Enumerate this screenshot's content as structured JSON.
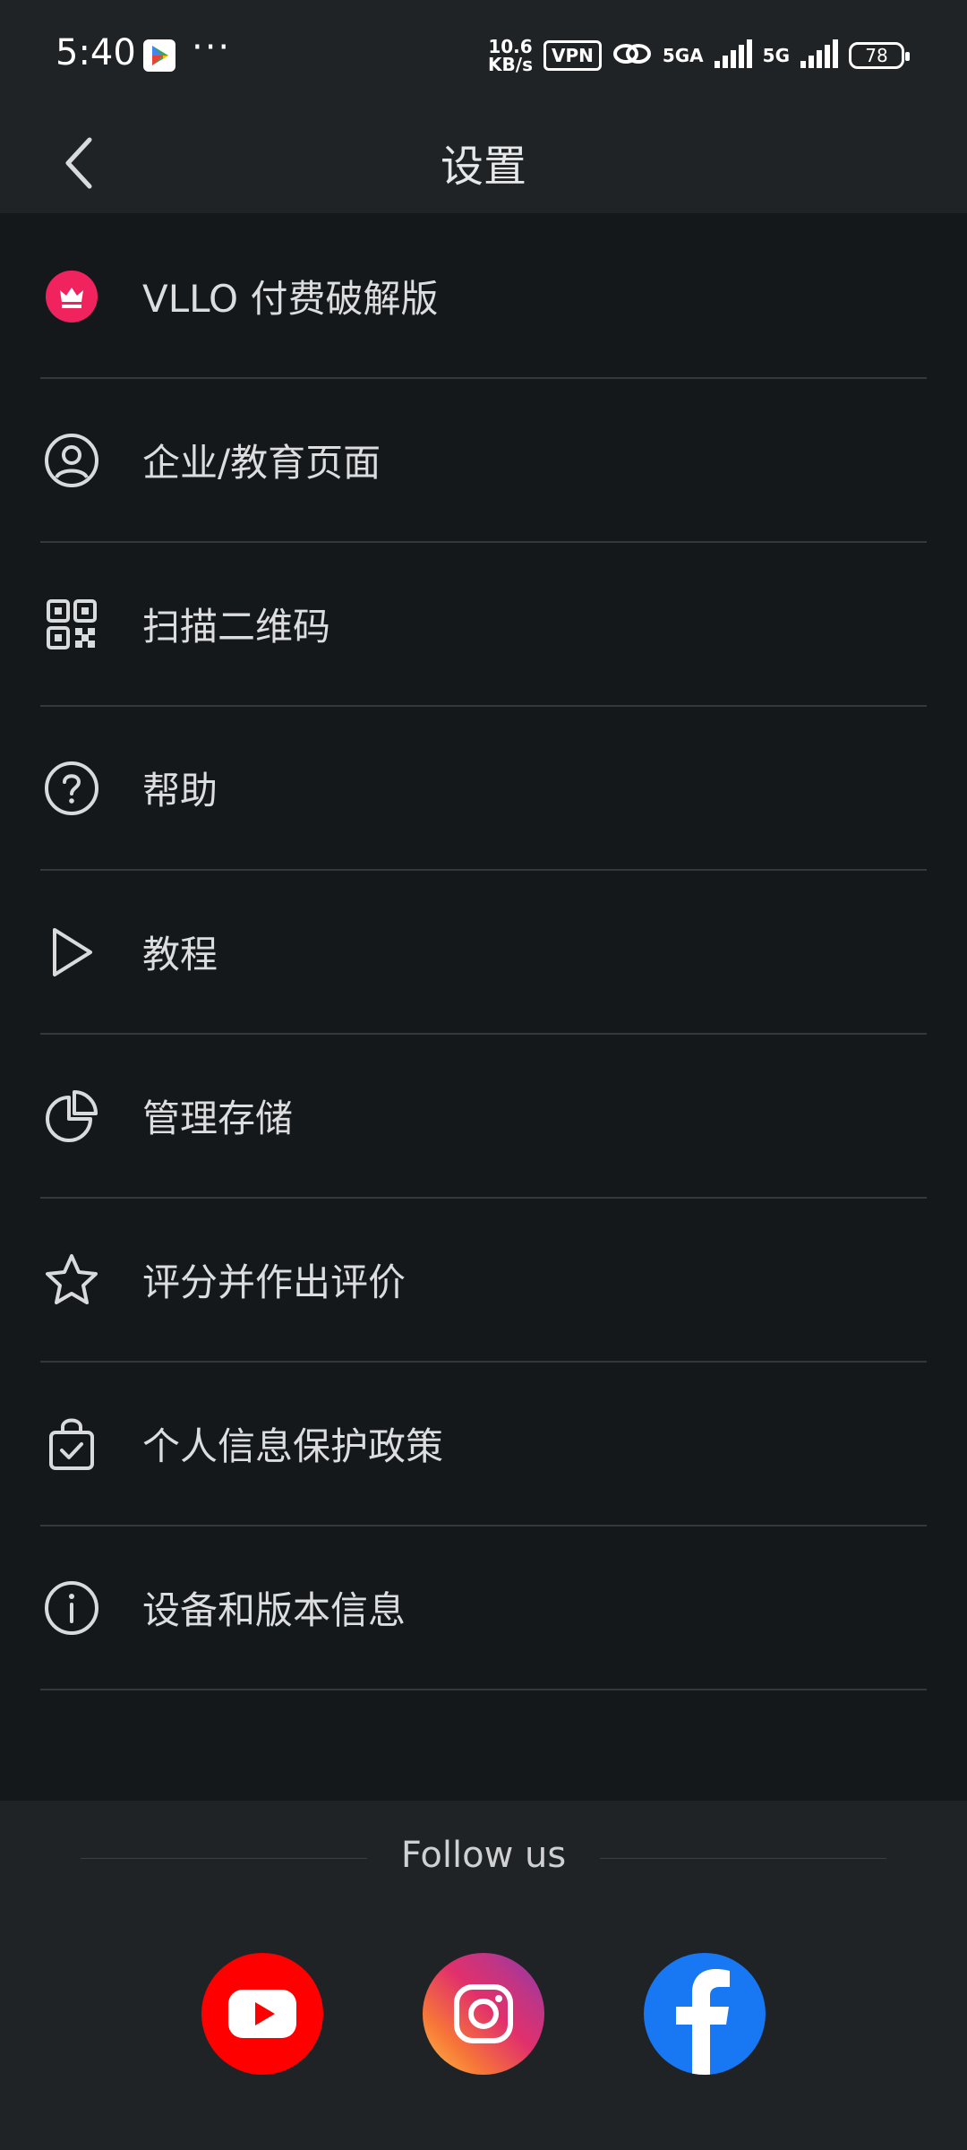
{
  "status": {
    "time": "5:40",
    "speed_top": "10.6",
    "speed_bottom": "KB/s",
    "vpn": "VPN",
    "net1": "5GA",
    "net2": "5G",
    "battery": "78"
  },
  "header": {
    "title": "设置"
  },
  "settings": {
    "items": [
      {
        "label": "VLLO 付费破解版"
      },
      {
        "label": "企业/教育页面"
      },
      {
        "label": "扫描二维码"
      },
      {
        "label": "帮助"
      },
      {
        "label": "教程"
      },
      {
        "label": "管理存储"
      },
      {
        "label": "评分并作出评价"
      },
      {
        "label": "个人信息保护政策"
      },
      {
        "label": "设备和版本信息"
      }
    ]
  },
  "follow": {
    "title": "Follow us"
  },
  "colors": {
    "background": "#15181b",
    "panel": "#202326",
    "crown_badge": "#f0235f",
    "youtube": "#ff0000",
    "facebook": "#1877f2"
  }
}
